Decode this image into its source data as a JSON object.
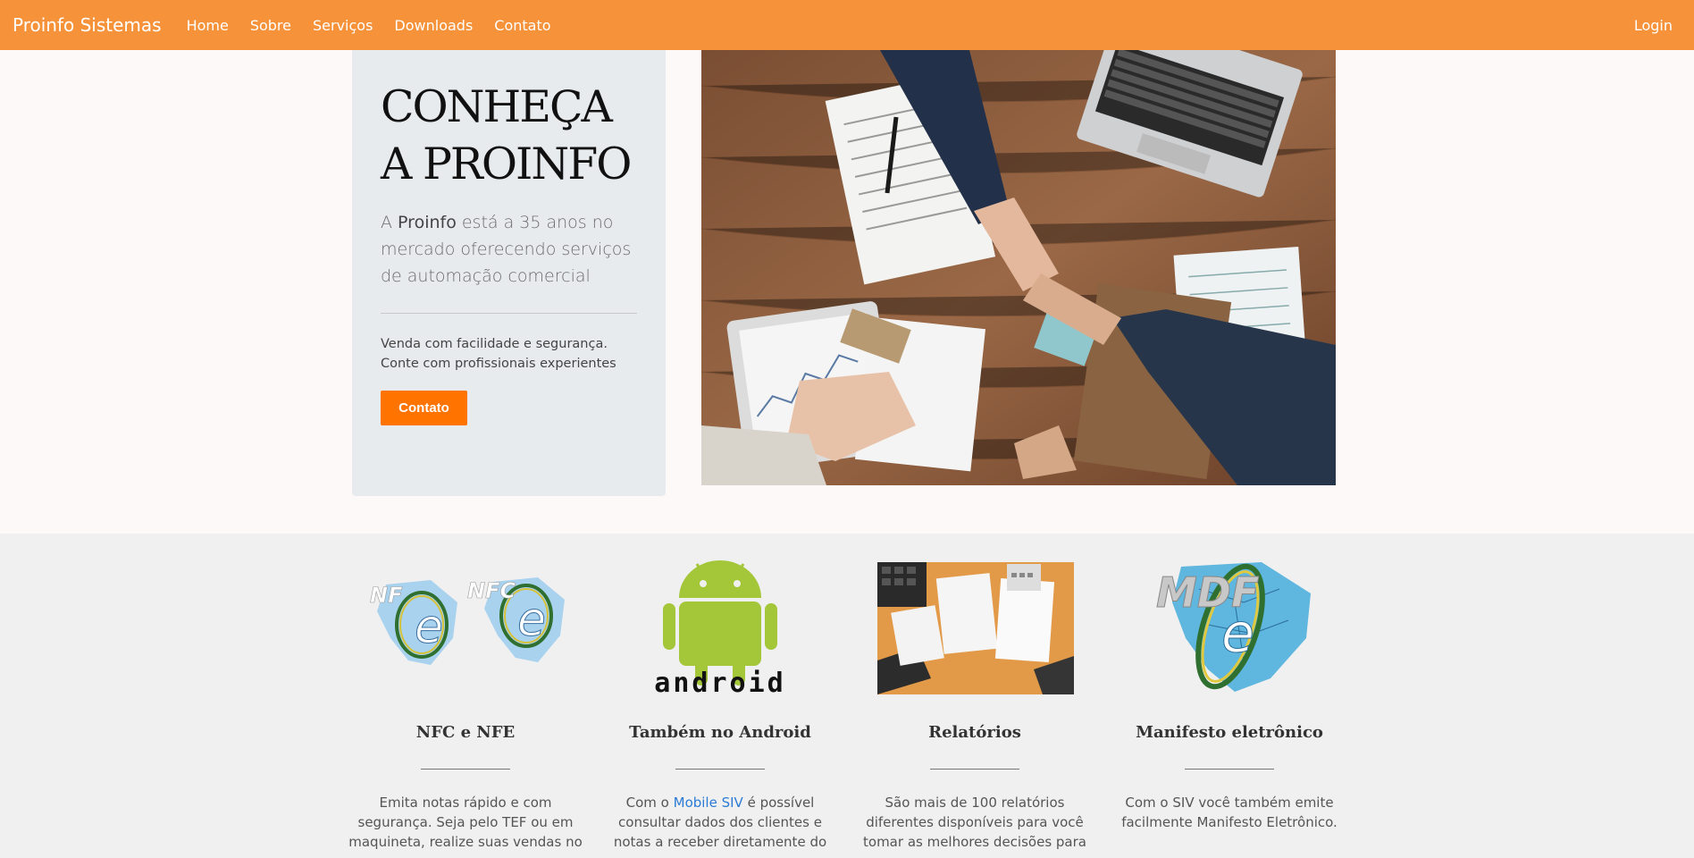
{
  "navbar": {
    "brand": "Proinfo Sistemas",
    "links": [
      "Home",
      "Sobre",
      "Serviços",
      "Downloads",
      "Contato"
    ],
    "login": "Login",
    "color": "#f5923a"
  },
  "hero": {
    "title_line1": "CONHEÇA",
    "title_line2": "A PROINFO",
    "lead_prefix": "A ",
    "lead_brand": "Proinfo",
    "lead_rest": " está a 35 anos no mercado oferecendo serviços de automação comercial",
    "sub_line1": "Venda com facilidade e segurança.",
    "sub_line2": "Conte com profissionais experientes",
    "button": "Contato",
    "button_color": "#ff7300"
  },
  "features": [
    {
      "title": "NFC e NFE",
      "text": "Emita notas rápido e com segurança. Seja pelo TEF ou em maquineta, realize suas vendas no",
      "icon": "nfe-logo-icon"
    },
    {
      "title": "Também no Android",
      "text_before": "Com o ",
      "link": "Mobile SIV",
      "text_after": " é possível consultar dados dos clientes e notas a receber diretamente do seu",
      "icon": "android-icon",
      "logo_text": "android"
    },
    {
      "title": "Relatórios",
      "text": "São mais de 100 relatórios diferentes disponíveis para você tomar as melhores decisões para",
      "icon": "reports-photo"
    },
    {
      "title": "Manifesto eletrônico",
      "text": "Com o SIV você também emite facilmente Manifesto Eletrônico.",
      "icon": "mdfe-logo-icon",
      "logo_text": "MDF",
      "logo_e": "e"
    }
  ],
  "nfe_logos": [
    "NF",
    "NFC",
    "e"
  ]
}
